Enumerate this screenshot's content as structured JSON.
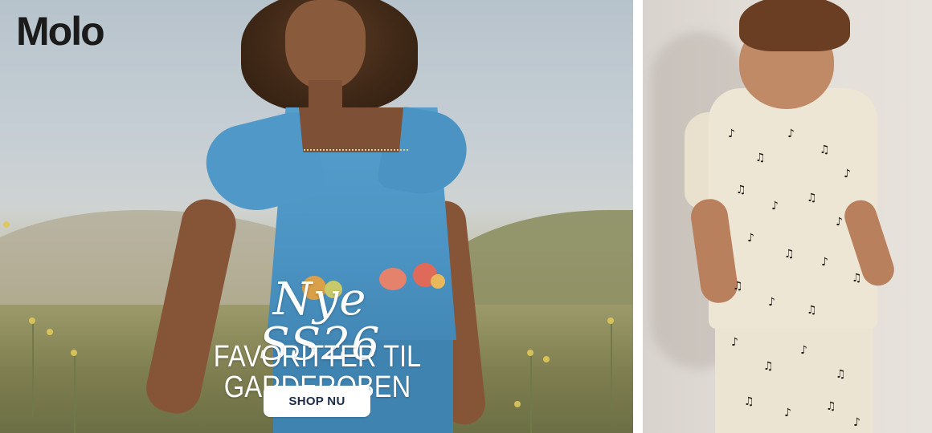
{
  "brand": {
    "logo_text": "Molo"
  },
  "hero": {
    "script_title": "Nye SS26",
    "headline": "FAVORITTER TIL GARDEROBEN",
    "cta_label": "SHOP NU"
  },
  "colors": {
    "cta_background": "#ffffff",
    "cta_text": "#1b2b48",
    "headline_text": "#ffffff",
    "logo_text": "#1b1b1b",
    "page_background": "#ffffff"
  },
  "images": {
    "left": "girl-in-blue-embroidered-top-meadow-photo",
    "right": "toddler-in-cream-music-note-print-set-photo"
  }
}
